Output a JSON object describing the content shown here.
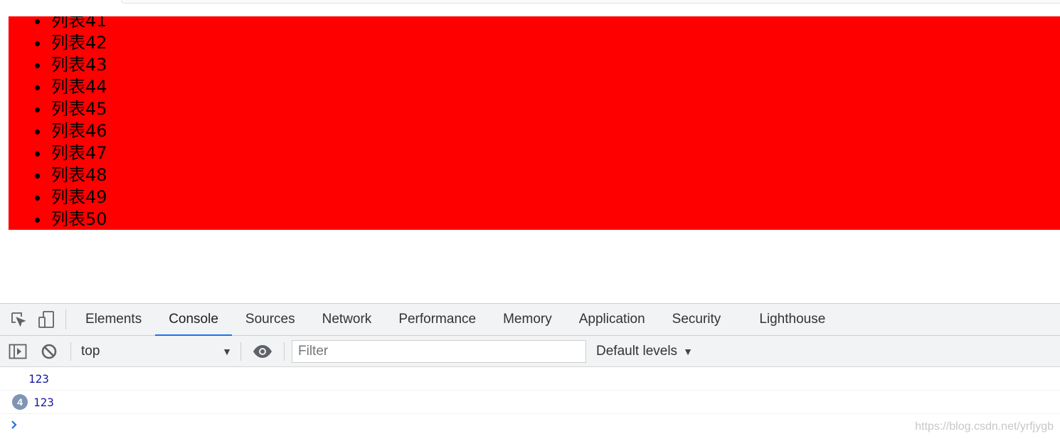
{
  "page": {
    "list_items": [
      "列表41",
      "列表42",
      "列表43",
      "列表44",
      "列表45",
      "列表46",
      "列表47",
      "列表48",
      "列表49",
      "列表50"
    ],
    "box_color": "#ff0000"
  },
  "devtools": {
    "tabs": [
      {
        "label": "Elements",
        "active": false
      },
      {
        "label": "Console",
        "active": true
      },
      {
        "label": "Sources",
        "active": false
      },
      {
        "label": "Network",
        "active": false
      },
      {
        "label": "Performance",
        "active": false
      },
      {
        "label": "Memory",
        "active": false
      },
      {
        "label": "Application",
        "active": false
      },
      {
        "label": "Security",
        "active": false
      },
      {
        "label": "Lighthouse",
        "active": false
      }
    ],
    "icons": {
      "inspect": "inspect-element-icon",
      "device": "device-toolbar-icon",
      "sidebar": "console-sidebar-icon",
      "clear": "clear-console-icon",
      "eye": "live-expression-icon",
      "prompt": "chevron-right-icon"
    },
    "toolbar": {
      "context": "top",
      "filter_placeholder": "Filter",
      "levels": "Default levels"
    },
    "messages": [
      {
        "text": "123",
        "count": ""
      },
      {
        "text": "123",
        "count": "4"
      }
    ],
    "accent": "#1a73e8"
  },
  "watermark": "https://blog.csdn.net/yrfjygb"
}
